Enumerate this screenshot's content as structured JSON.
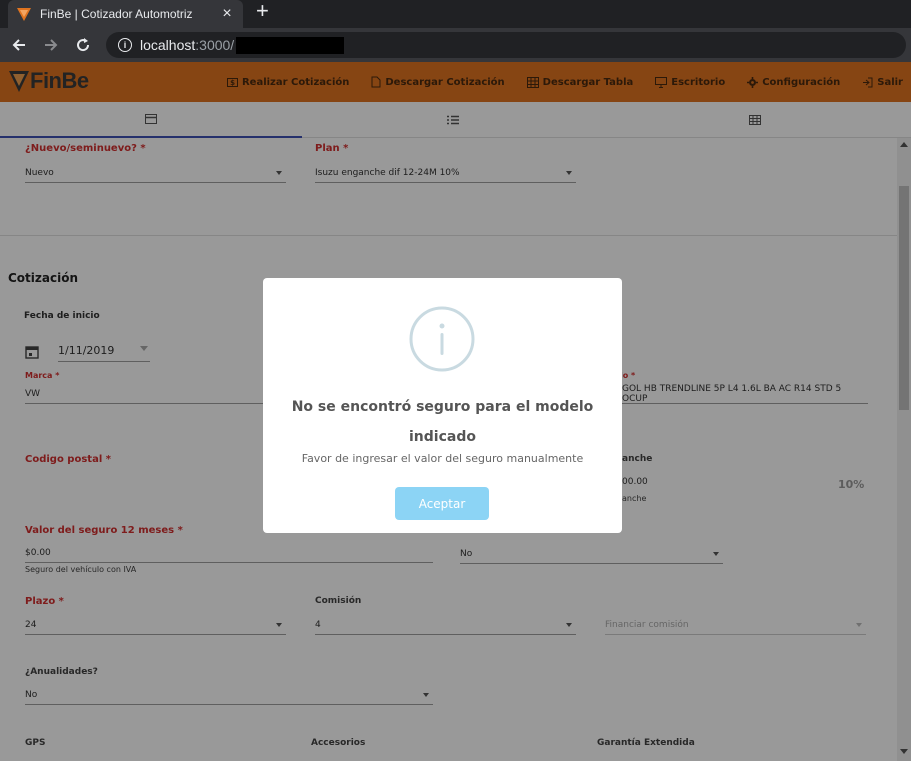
{
  "browser": {
    "tab_title": "FinBe | Cotizador Automotriz",
    "tab_close": "×",
    "new_tab": "+",
    "url_host": "localhost",
    "url_rest": ":3000/"
  },
  "app": {
    "logo": "FinBe",
    "menu": [
      {
        "label": "Realizar Cotización",
        "icon": "dollar-icon"
      },
      {
        "label": "Descargar Cotización",
        "icon": "file-icon"
      },
      {
        "label": "Descargar Tabla",
        "icon": "table-icon"
      },
      {
        "label": "Escritorio",
        "icon": "desktop-icon"
      },
      {
        "label": "Configuración",
        "icon": "gear-icon"
      },
      {
        "label": "Salir",
        "icon": "logout-icon"
      }
    ],
    "tabs": [
      {
        "icon": "card-icon",
        "active": true
      },
      {
        "icon": "list-icon",
        "active": false
      },
      {
        "icon": "grid-icon",
        "active": false
      }
    ],
    "accent_color": "#e07420",
    "tab_indicator_color": "#3f51b5"
  },
  "form": {
    "nuevo_label": "¿Nuevo/seminuevo? *",
    "nuevo_value": "Nuevo",
    "plan_label": "Plan *",
    "plan_value": "Isuzu enganche dif 12-24M 10%",
    "section_title": "Cotización",
    "fecha_label": "Fecha de inicio",
    "fecha_value": "1/11/2019",
    "marca_label": "Marca *",
    "marca_value": "VW",
    "modelo_label_partial": "lo *",
    "modelo_value_partial": "GOL HB TRENDLINE 5P L4 1.6L BA AC R14 STD 5 OCUP",
    "cp_label": "Codigo postal *",
    "enganche_label_partial": "anche",
    "enganche_value_partial": "00.00",
    "enganche_helper_partial": "anche",
    "enganche_percent": "10%",
    "valor_seguro_label": "Valor del seguro 12 meses *",
    "valor_seguro_value": "$0.00",
    "valor_seguro_helper": "Seguro del vehículo con IVA",
    "seguro_fin_value": "No",
    "plazo_label": "Plazo *",
    "plazo_value": "24",
    "comision_label": "Comisión",
    "comision_value": "4",
    "financiar_comision_placeholder": "Financiar comisión",
    "anualidades_label": "¿Anualidades?",
    "anualidades_value": "No",
    "gps_label": "GPS",
    "accesorios_label": "Accesorios",
    "garantia_label": "Garantía Extendida"
  },
  "modal": {
    "title": "No se encontró seguro para el modelo indicado",
    "text": "Favor de ingresar el valor del seguro manualmente",
    "button": "Aceptar",
    "button_color": "#8cd4f5",
    "icon": "info-icon"
  }
}
